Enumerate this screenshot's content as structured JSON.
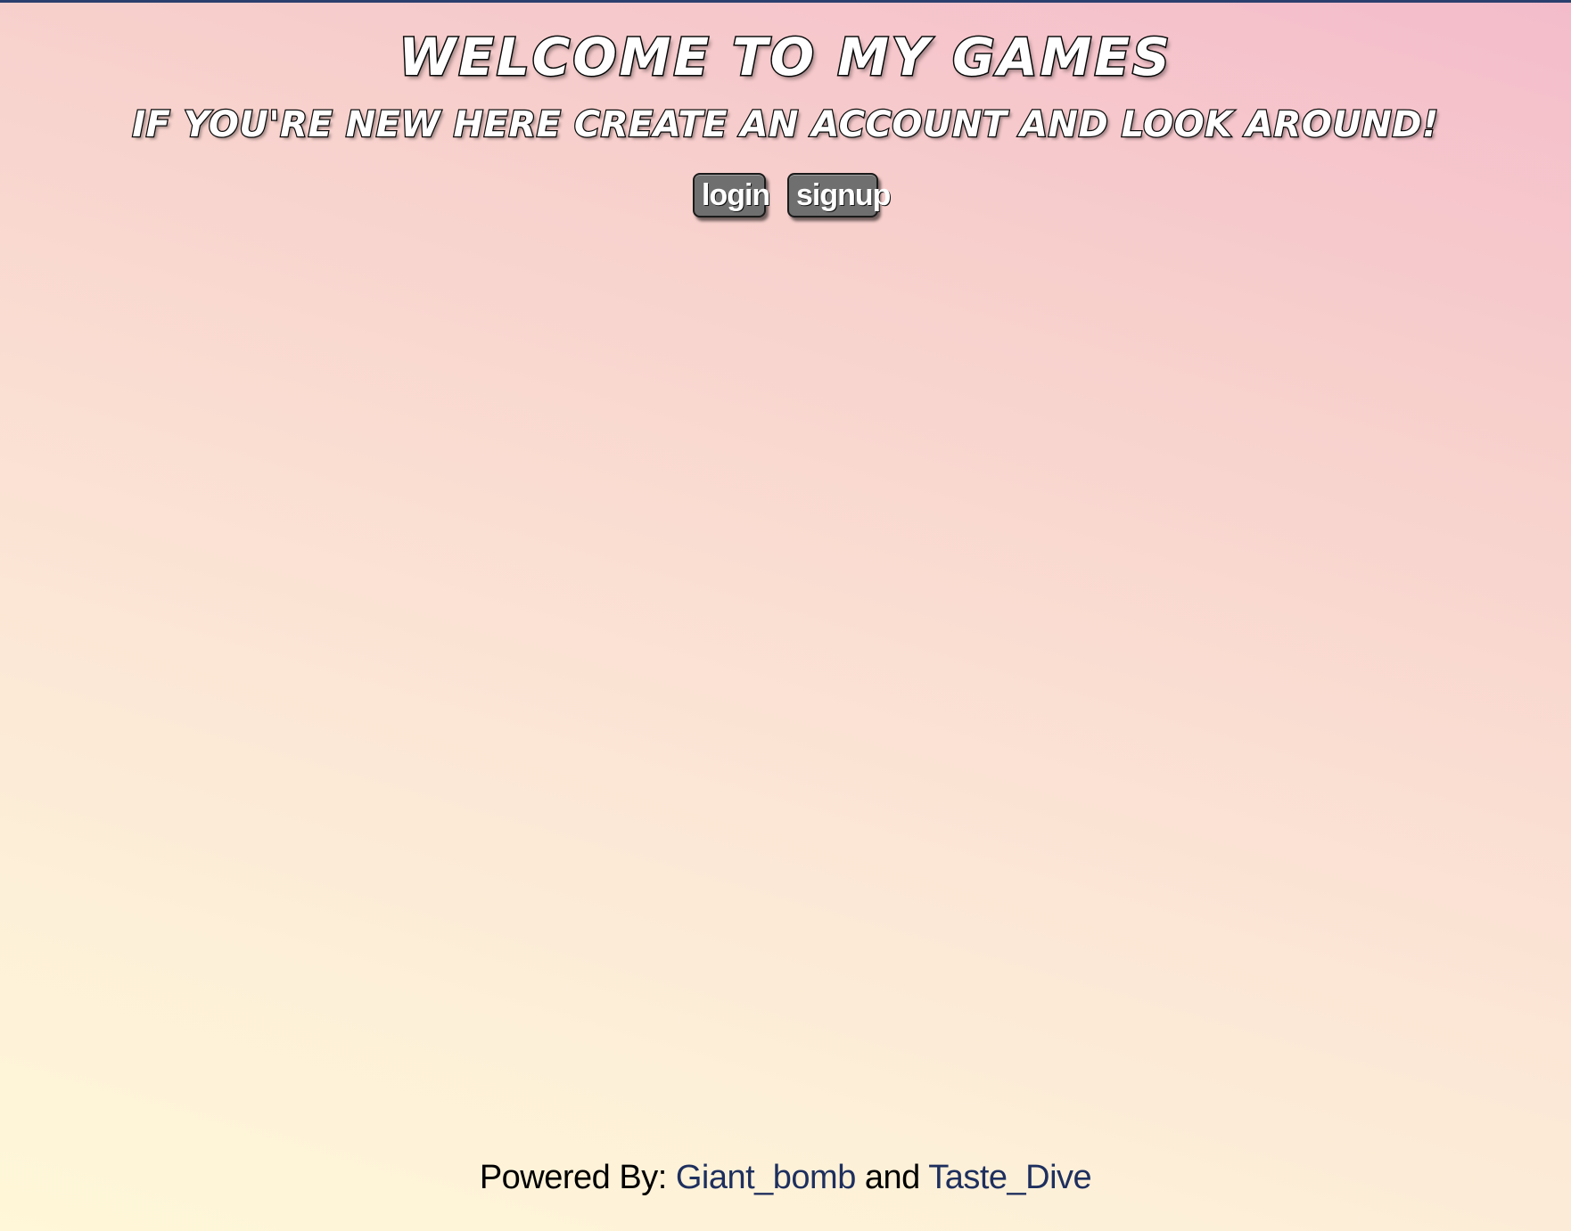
{
  "page": {
    "headline": "WELCOME TO MY GAMES",
    "subheadline": "IF YOU'RE NEW HERE CREATE AN ACCOUNT AND LOOK AROUND!"
  },
  "auth": {
    "login_label": "login",
    "signup_label": "signup"
  },
  "footer": {
    "prefix": "Powered By:",
    "link1": "Giant_bomb",
    "joiner": "and",
    "link2": "Taste_Dive"
  },
  "colors": {
    "top_rule": "#2b3f6e",
    "button_bg": "#6f6f6f",
    "link": "#1e2f5e",
    "gradient_top_right": "#f4bccb",
    "gradient_bottom_left": "#fff7d8"
  }
}
